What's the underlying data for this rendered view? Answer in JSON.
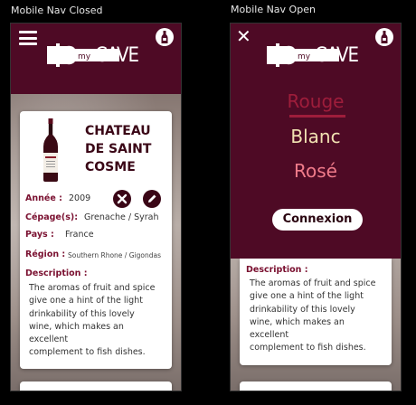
{
  "captions": {
    "left": "Mobile Nav Closed",
    "right": "Mobile Nav Open"
  },
  "logo": {
    "my": "my",
    "cave": "CAVE"
  },
  "wine": {
    "name_line1": "CHATEAU",
    "name_line2": "DE SAINT",
    "name_line3": "COSME",
    "year_label": "Année :",
    "year_value": "2009",
    "cepage_label": "Cépage(s):",
    "cepage_value": "Grenache / Syrah",
    "pays_label": "Pays :",
    "pays_value": "France",
    "region_label": "Région :",
    "region_value": "Southern Rhone / Gigondas",
    "description_label": "Description :",
    "description_lines": [
      "The aromas of fruit and spice",
      "give one a hint of the light",
      "drinkability of this lovely",
      "wine, which makes an",
      "excellent",
      "complement to fish dishes."
    ]
  },
  "nav": {
    "items": [
      "Rouge",
      "Blanc",
      "Rosé"
    ],
    "connexion": "Connexion"
  },
  "icons": {
    "menu": "hamburger-icon",
    "close": "close-icon",
    "bottle": "bottle-icon",
    "delete": "delete-icon",
    "edit": "edit-icon"
  },
  "colors": {
    "header": "#4e0a25",
    "rouge": "#9e1d3b",
    "blanc": "#f1e2b2",
    "rose": "#f07b8a"
  }
}
